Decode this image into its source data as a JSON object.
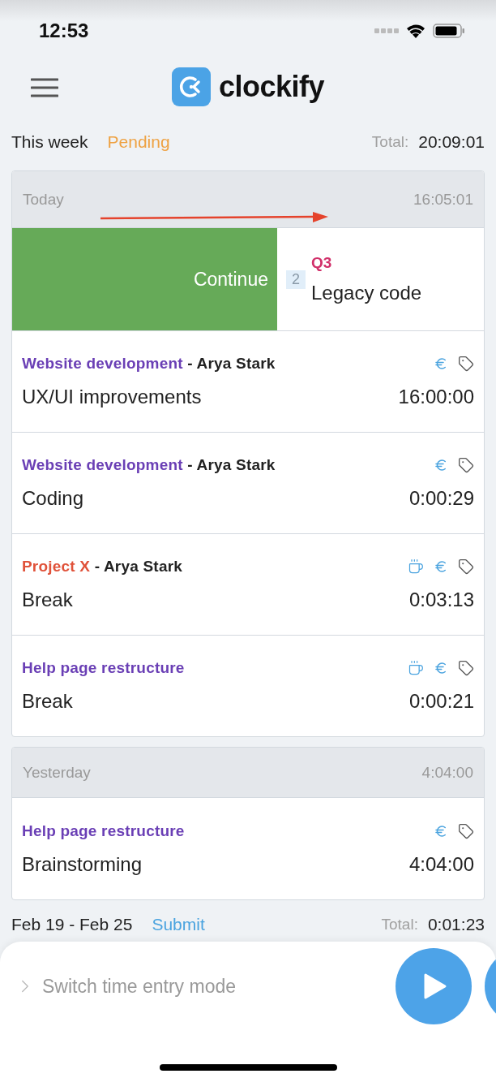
{
  "status_bar": {
    "time": "12:53"
  },
  "app": {
    "logo_text": "clockify"
  },
  "week": {
    "label": "This week",
    "status": "Pending",
    "total_label": "Total:",
    "total": "20:09:01"
  },
  "days": [
    {
      "label": "Today",
      "total": "16:05:01",
      "swiped": {
        "action": "Continue",
        "count": "2",
        "project": "Q3",
        "color": "#d1306a",
        "description": "Legacy code"
      },
      "entries": [
        {
          "project": "Website development",
          "color": "#6a3fb5",
          "client": "- Arya Stark",
          "description": "UX/UI improvements",
          "duration": "16:00:00",
          "break": false,
          "billable": true
        },
        {
          "project": "Website development",
          "color": "#6a3fb5",
          "client": "- Arya Stark",
          "description": "Coding",
          "duration": "0:00:29",
          "break": false,
          "billable": true
        },
        {
          "project": "Project X",
          "color": "#e0523a",
          "client": "- Arya Stark",
          "description": "Break",
          "duration": "0:03:13",
          "break": true,
          "billable": true
        },
        {
          "project": "Help page restructure",
          "color": "#6a3fb5",
          "description": "Break",
          "duration": "0:00:21",
          "break": true,
          "billable": true
        }
      ]
    },
    {
      "label": "Yesterday",
      "total": "4:04:00",
      "entries": [
        {
          "project": "Help page restructure",
          "color": "#6a3fb5",
          "description": "Brainstorming",
          "duration": "4:04:00",
          "break": false,
          "billable": true
        }
      ]
    }
  ],
  "previous_week": {
    "label": "Feb 19 - Feb 25",
    "action": "Submit",
    "total_label": "Total:",
    "total": "0:01:23"
  },
  "entry_bar": {
    "mode_label": "Switch time entry mode"
  }
}
